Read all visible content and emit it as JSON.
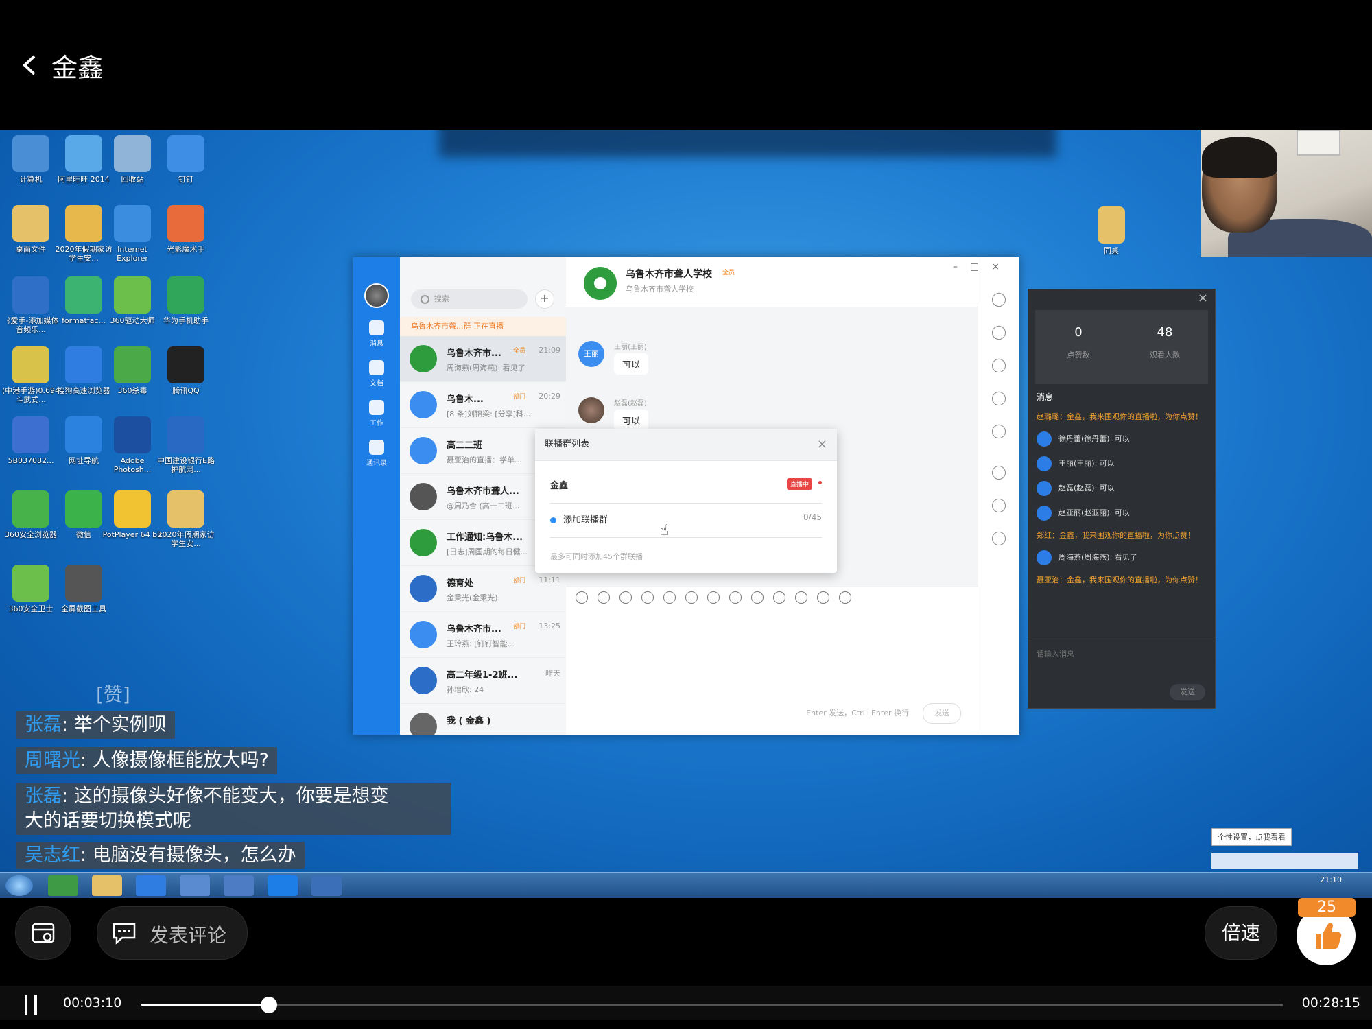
{
  "header": {
    "title": "金鑫"
  },
  "desktop": {
    "icons": [
      {
        "label": "计算机",
        "color": "#4a8fd6"
      },
      {
        "label": "阿里旺旺 2014",
        "color": "#59a8e8"
      },
      {
        "label": "回收站",
        "color": "#8fb4d8"
      },
      {
        "label": "钉钉",
        "color": "#3e8ee6"
      },
      {
        "label": "桌面文件",
        "color": "#e5c26a"
      },
      {
        "label": "2020年假期家访学生安...",
        "color": "#e7b94c"
      },
      {
        "label": "Internet Explorer",
        "color": "#3b8de0"
      },
      {
        "label": "光影魔术手",
        "color": "#e86b3c"
      },
      {
        "label": "《爱手-添加媒体音频乐...",
        "color": "#2f6fc8"
      },
      {
        "label": "formatfac...",
        "color": "#3cb371"
      },
      {
        "label": "360驱动大师",
        "color": "#6cbf4a"
      },
      {
        "label": "华为手机助手",
        "color": "#2fa65a"
      },
      {
        "label": "(中港手游)0.694斗武式...",
        "color": "#d8c24a"
      },
      {
        "label": "搜狗高速浏览器",
        "color": "#2f7de0"
      },
      {
        "label": "360杀毒",
        "color": "#4ca948"
      },
      {
        "label": "腾讯QQ",
        "color": "#222222"
      },
      {
        "label": "5B037082...",
        "color": "#3d6fd0"
      },
      {
        "label": "网址导航",
        "color": "#2c82df"
      },
      {
        "label": "Adobe Photosh...",
        "color": "#1d4fa0"
      },
      {
        "label": "中国建设银行E路护航网...",
        "color": "#2a69c3"
      },
      {
        "label": "360安全浏览器",
        "color": "#47b14a"
      },
      {
        "label": "微信",
        "color": "#3cb34a"
      },
      {
        "label": "PotPlayer 64 bit",
        "color": "#f1c232"
      },
      {
        "label": "2020年假期家访学生安...",
        "color": "#e5c26a"
      },
      {
        "label": "360安全卫士",
        "color": "#6cbf4a"
      },
      {
        "label": "全屏截图工具",
        "color": "#555555"
      },
      {
        "label": "同桌",
        "color": "#e5c26a"
      }
    ]
  },
  "dingtalk": {
    "rail": [
      "消息",
      "文档",
      "工作",
      "通讯录"
    ],
    "search_placeholder": "搜索",
    "live_banner": "乌鲁木齐市聋...群 正在直播",
    "conversations": [
      {
        "name": "乌鲁木齐市...",
        "tag": "全员",
        "time": "21:09",
        "msg": "周海燕(周海燕): 看见了"
      },
      {
        "name": "乌鲁木...",
        "tag": "部门",
        "time": "20:29",
        "msg": "[8 条]刘锦梁: [分享]科..."
      },
      {
        "name": "高二二班",
        "tag": "",
        "time": "",
        "msg": "聂亚治的直播：学单..."
      },
      {
        "name": "乌鲁木齐市聋人...",
        "tag": "",
        "time": "",
        "msg": "@周乃合 (高一二班..."
      },
      {
        "name": "工作通知:乌鲁木...",
        "tag": "",
        "time": "",
        "msg": "[日志]周国期的每日健..."
      },
      {
        "name": "德育处",
        "tag": "部门",
        "time": "11:11",
        "msg": "金秉光(金秉光):"
      },
      {
        "name": "乌鲁木齐市...",
        "tag": "部门",
        "time": "13:25",
        "msg": "王玲燕: [钉钉智能..."
      },
      {
        "name": "高二年级1-2班...",
        "tag": "",
        "time": "昨天",
        "msg": "孙增欣: 24"
      },
      {
        "name": "我 ( 金鑫 )",
        "tag": "",
        "time": "",
        "msg": ""
      }
    ],
    "chat": {
      "group_name": "乌鲁木齐市聋人学校",
      "group_tag": "全员",
      "group_sub": "乌鲁木齐市聋人学校",
      "messages": [
        {
          "sender": "王丽(王丽)",
          "avatar_text": "王丽",
          "text": "可以"
        },
        {
          "sender": "赵磊(赵磊)",
          "avatar_text": "",
          "text": "可以"
        }
      ],
      "send_hint": "Enter 发送，Ctrl+Enter 换行",
      "send_label": "发送"
    },
    "popup": {
      "title": "联播群列表",
      "row1_label": "金鑫",
      "row1_badge": "直播中",
      "row2_label": "添加联播群",
      "row2_count": "0/45",
      "note": "最多可同时添加45个群联播"
    }
  },
  "live_panel": {
    "likes_value": "0",
    "likes_label": "点赞数",
    "viewers_value": "48",
    "viewers_label": "观看人数",
    "title": "消息",
    "messages": [
      {
        "type": "warn",
        "text": "赵璐璐：金鑫，我来围观你的直播啦，为你点赞！"
      },
      {
        "type": "user",
        "text": "徐丹蕾(徐丹蕾): 可以"
      },
      {
        "type": "user",
        "text": "王丽(王丽): 可以"
      },
      {
        "type": "user",
        "text": "赵磊(赵磊): 可以"
      },
      {
        "type": "user",
        "text": "赵亚丽(赵亚丽): 可以"
      },
      {
        "type": "warn",
        "text": "郑红：金鑫，我来围观你的直播啦，为你点赞！"
      },
      {
        "type": "user",
        "text": "周海燕(周海燕): 看见了"
      },
      {
        "type": "warn",
        "text": "聂亚治：金鑫，我来围观你的直播啦，为你点赞！"
      }
    ],
    "input_placeholder": "请输入消息",
    "send_label": "发送"
  },
  "comments": [
    {
      "name": "张磊",
      "text": "举个实例呗"
    },
    {
      "name": "周曙光",
      "text": "人像摄像框能放大吗?"
    },
    {
      "name": "张磊",
      "text": "这的摄像头好像不能变大，你要是想变",
      "text2": "大的话要切换模式呢"
    },
    {
      "name": "吴志红",
      "text": "电脑没有摄像头，怎么办"
    }
  ],
  "floating_like": "[赞]",
  "taskbar": {
    "ime_tip": "个性设置，点我看看",
    "clock": "21:10"
  },
  "controls": {
    "comment_label": "发表评论",
    "speed_label": "倍速",
    "like_count": "25",
    "current_time": "00:03:10",
    "total_time": "00:28:15",
    "progress": 0.112
  },
  "colors": {
    "accent_blue": "#2f9cf2",
    "like_orange": "#f08a2a",
    "live_red": "#e84545",
    "dingtalk_blue": "#1e7ee8"
  }
}
